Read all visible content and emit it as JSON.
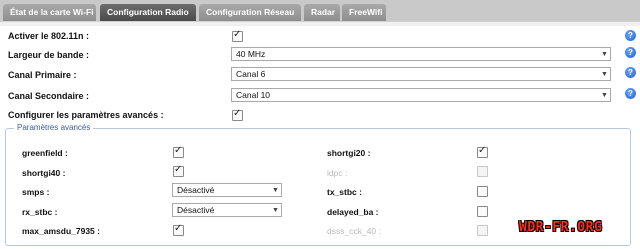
{
  "tabs": [
    {
      "label": "État de la carte Wi-Fi",
      "active": false
    },
    {
      "label": "Configuration Radio",
      "active": true
    },
    {
      "label": "Configuration Réseau",
      "active": false
    },
    {
      "label": "Radar",
      "active": false
    },
    {
      "label": "FreeWifi",
      "active": false
    }
  ],
  "rows": {
    "enable_80211n": {
      "label": "Activer le 802.11n :",
      "checked": true
    },
    "bandwidth": {
      "label": "Largeur de bande :",
      "value": "40 MHz"
    },
    "primary_channel": {
      "label": "Canal Primaire :",
      "value": "Canal 6"
    },
    "secondary_channel": {
      "label": "Canal Secondaire :",
      "value": "Canal 10"
    },
    "advanced": {
      "label": "Configurer les paramètres avancés :",
      "checked": true
    }
  },
  "help_icon": "?",
  "advanced_section": {
    "legend": "Paramètres avancés",
    "left": [
      {
        "label": "greenfield :",
        "type": "checkbox",
        "checked": true
      },
      {
        "label": "shortgi40 :",
        "type": "checkbox",
        "checked": true
      },
      {
        "label": "smps :",
        "type": "select",
        "value": "Désactivé"
      },
      {
        "label": "rx_stbc :",
        "type": "select",
        "value": "Désactivé"
      },
      {
        "label": "max_amsdu_7935 :",
        "type": "checkbox",
        "checked": true
      }
    ],
    "right": [
      {
        "label": "shortgi20 :",
        "checked": true,
        "disabled": false
      },
      {
        "label": "ldpc :",
        "checked": false,
        "disabled": true
      },
      {
        "label": "tx_stbc :",
        "checked": false,
        "disabled": false
      },
      {
        "label": "delayed_ba :",
        "checked": false,
        "disabled": false
      },
      {
        "label": "dsss_cck_40 :",
        "checked": false,
        "disabled": true
      }
    ]
  },
  "watermark": "WDR-FR.ORG",
  "icons": {
    "check": "check-icon",
    "dropdown": "chevron-down-icon",
    "help": "help-icon"
  }
}
